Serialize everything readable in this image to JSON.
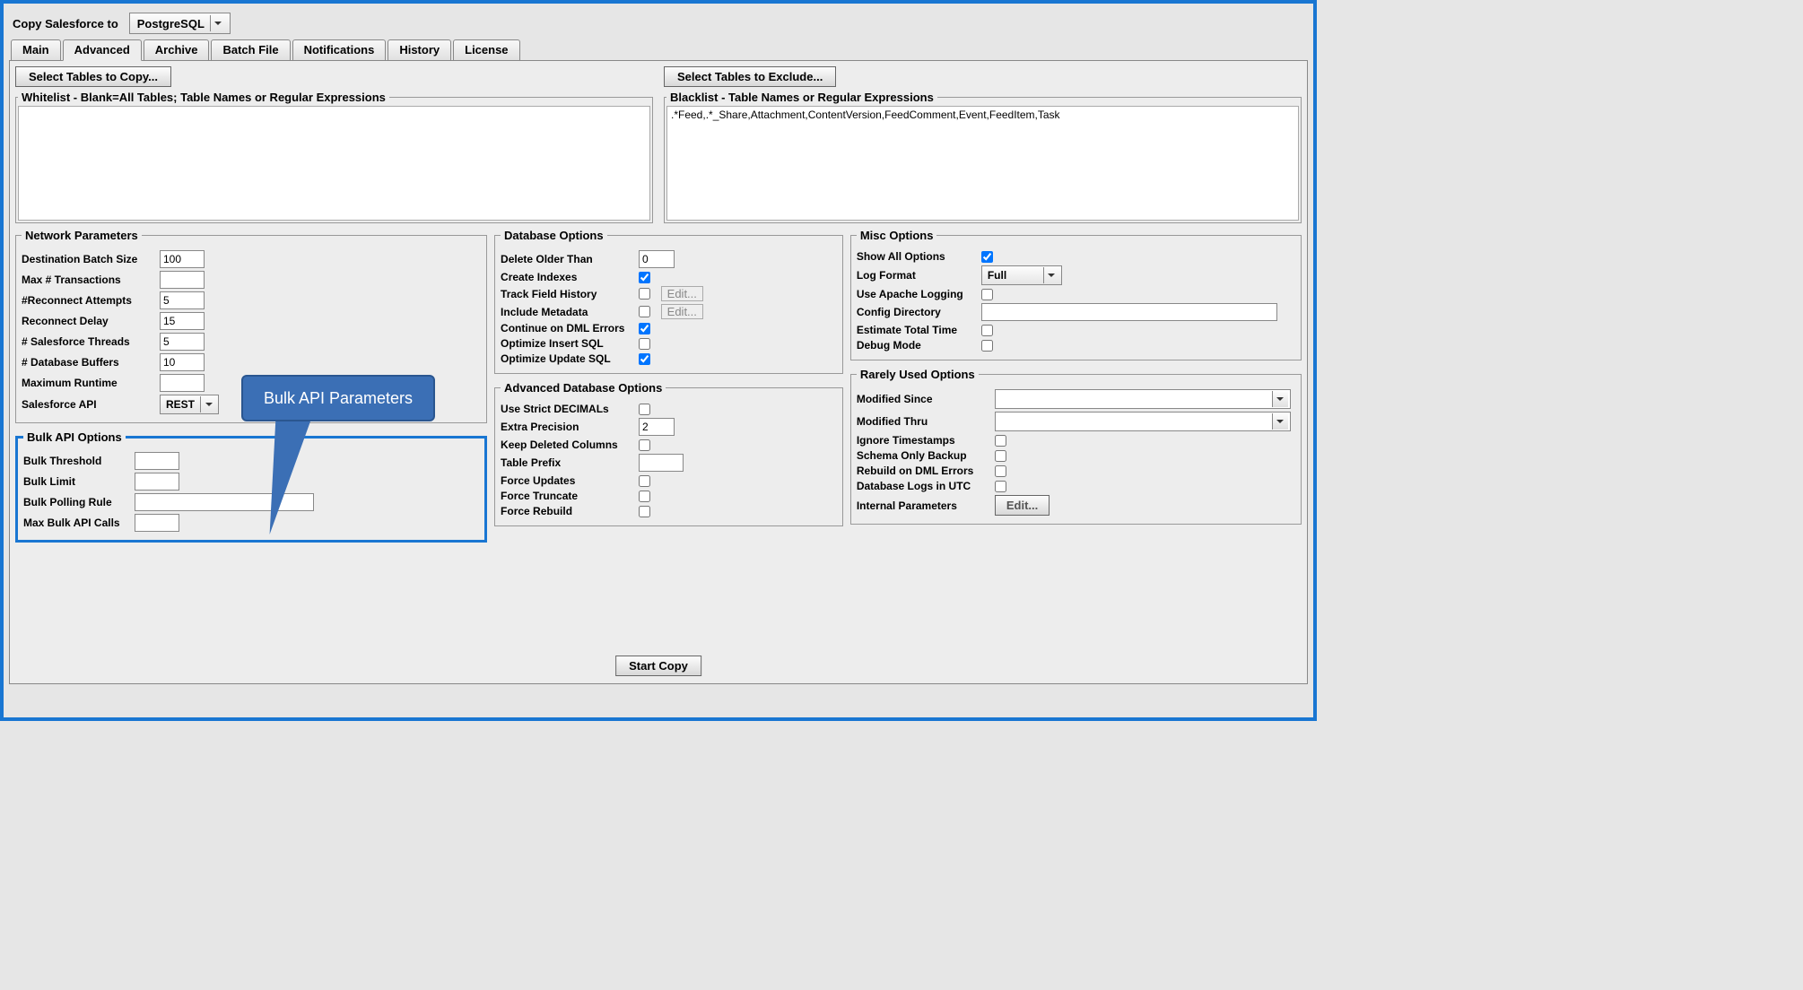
{
  "header": {
    "title": "Copy Salesforce to",
    "destination": "PostgreSQL"
  },
  "tabs": [
    "Main",
    "Advanced",
    "Archive",
    "Batch File",
    "Notifications",
    "History",
    "License"
  ],
  "activeTab": "Advanced",
  "selectTablesBtn": "Select Tables to Copy...",
  "selectExcludeBtn": "Select Tables to Exclude...",
  "whitelist": {
    "legend": "Whitelist - Blank=All Tables; Table Names or Regular Expressions",
    "value": ""
  },
  "blacklist": {
    "legend": "Blacklist - Table Names or Regular Expressions",
    "value": ".*Feed,.*_Share,Attachment,ContentVersion,FeedComment,Event,FeedItem,Task"
  },
  "network": {
    "legend": "Network Parameters",
    "destBatchLabel": "Destination Batch Size",
    "destBatch": "100",
    "maxTransLabel": "Max # Transactions",
    "maxTrans": "",
    "reconnAttLabel": "#Reconnect Attempts",
    "reconnAtt": "5",
    "reconnDelayLabel": "Reconnect Delay",
    "reconnDelay": "15",
    "sfThreadsLabel": "# Salesforce Threads",
    "sfThreads": "5",
    "dbBuffersLabel": "# Database Buffers",
    "dbBuffers": "10",
    "maxRuntimeLabel": "Maximum Runtime",
    "maxRuntime": "",
    "sfApiLabel": "Salesforce API",
    "sfApi": "REST"
  },
  "bulk": {
    "legend": "Bulk API Options",
    "thresholdLabel": "Bulk Threshold",
    "threshold": "",
    "limitLabel": "Bulk Limit",
    "limit": "",
    "pollingLabel": "Bulk Polling Rule",
    "polling": "",
    "maxCallsLabel": "Max Bulk API Calls",
    "maxCalls": ""
  },
  "db": {
    "legend": "Database Options",
    "deleteOlderLabel": "Delete Older Than",
    "deleteOlder": "0",
    "createIndexesLabel": "Create Indexes",
    "createIndexes": true,
    "trackHistoryLabel": "Track Field History",
    "trackHistory": false,
    "includeMetaLabel": "Include Metadata",
    "includeMeta": false,
    "contDmlLabel": "Continue on DML Errors",
    "contDml": true,
    "optInsertLabel": "Optimize Insert SQL",
    "optInsert": false,
    "optUpdateLabel": "Optimize Update SQL",
    "optUpdate": true,
    "editBtn": "Edit..."
  },
  "advdb": {
    "legend": "Advanced Database Options",
    "strictDecLabel": "Use Strict DECIMALs",
    "strictDec": false,
    "extraPrecLabel": "Extra Precision",
    "extraPrec": "2",
    "keepDelLabel": "Keep Deleted Columns",
    "keepDel": false,
    "tablePrefixLabel": "Table Prefix",
    "tablePrefix": "",
    "forceUpdLabel": "Force Updates",
    "forceUpd": false,
    "forceTruncLabel": "Force Truncate",
    "forceTrunc": false,
    "forceRebuildLabel": "Force Rebuild",
    "forceRebuild": false
  },
  "misc": {
    "legend": "Misc Options",
    "showAllLabel": "Show All Options",
    "showAll": true,
    "logFormatLabel": "Log Format",
    "logFormat": "Full",
    "apacheLogLabel": "Use Apache Logging",
    "apacheLog": false,
    "configDirLabel": "Config Directory",
    "configDir": "",
    "estTimeLabel": "Estimate Total Time",
    "estTime": false,
    "debugLabel": "Debug Mode",
    "debug": false
  },
  "rarely": {
    "legend": "Rarely Used Options",
    "modSinceLabel": "Modified Since",
    "modSince": "",
    "modThruLabel": "Modified Thru",
    "modThru": "",
    "ignoreTsLabel": "Ignore Timestamps",
    "ignoreTs": false,
    "schemaOnlyLabel": "Schema Only Backup",
    "schemaOnly": false,
    "rebuildDmlLabel": "Rebuild on DML Errors",
    "rebuildDml": false,
    "dbLogsUtcLabel": "Database Logs in UTC",
    "dbLogsUtc": false,
    "internalParamsLabel": "Internal Parameters",
    "editBtn": "Edit..."
  },
  "callout": "Bulk API Parameters",
  "startCopy": "Start Copy"
}
